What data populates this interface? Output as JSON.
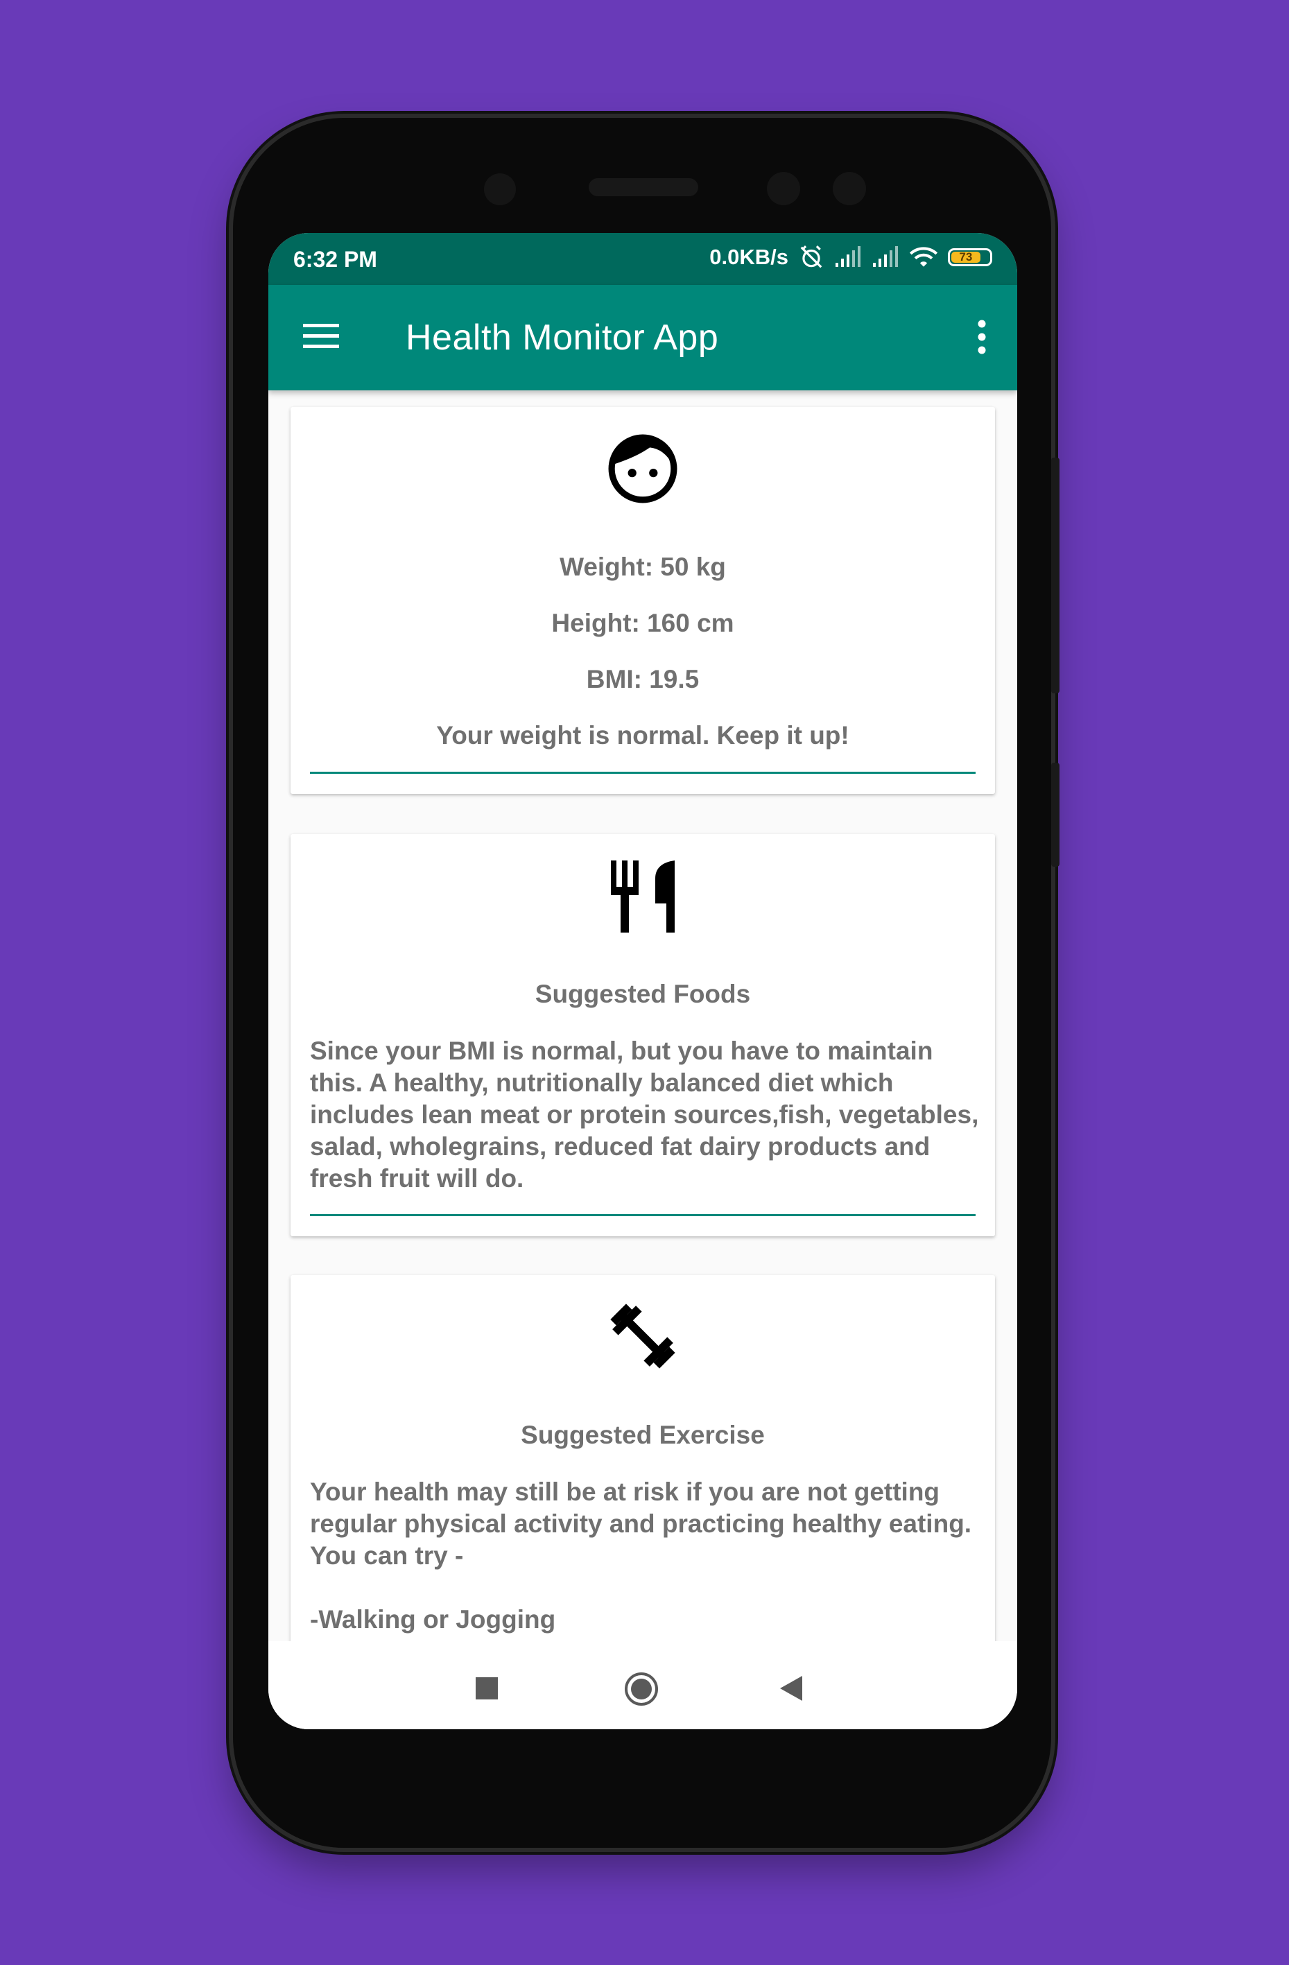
{
  "status_bar": {
    "time": "6:32 PM",
    "network_speed": "0.0KB/s",
    "battery_level": "73"
  },
  "app_bar": {
    "title": "Health Monitor App",
    "menu_icon": "hamburger-menu-icon",
    "more_icon": "more-vertical-icon"
  },
  "profile_card": {
    "icon": "face-icon",
    "weight": "Weight: 50 kg",
    "height": "Height: 160 cm",
    "bmi": "BMI: 19.5",
    "message": "Your weight is normal. Keep it up!"
  },
  "foods_card": {
    "icon": "restaurant-icon",
    "title": "Suggested Foods",
    "body": "Since your BMI is normal, but you have to maintain this. A healthy, nutritionally balanced diet which includes lean meat or protein sources,fish, vegetables, salad, wholegrains, reduced fat dairy products and fresh fruit will do."
  },
  "exercise_card": {
    "icon": "fitness-dumbbell-icon",
    "title": "Suggested Exercise",
    "body": "Your health may still be at risk if you are not getting regular physical activity and practicing healthy eating. You can try -",
    "list_item_1": "-Walking or Jogging"
  },
  "nav_bar": {
    "recents_icon": "square-recents-icon",
    "home_icon": "circle-home-icon",
    "back_icon": "triangle-back-icon"
  },
  "colors": {
    "background": "#693ab8",
    "status_bar": "#00695c",
    "app_bar": "#00887a",
    "card_text": "#707070",
    "divider": "#00887a"
  }
}
